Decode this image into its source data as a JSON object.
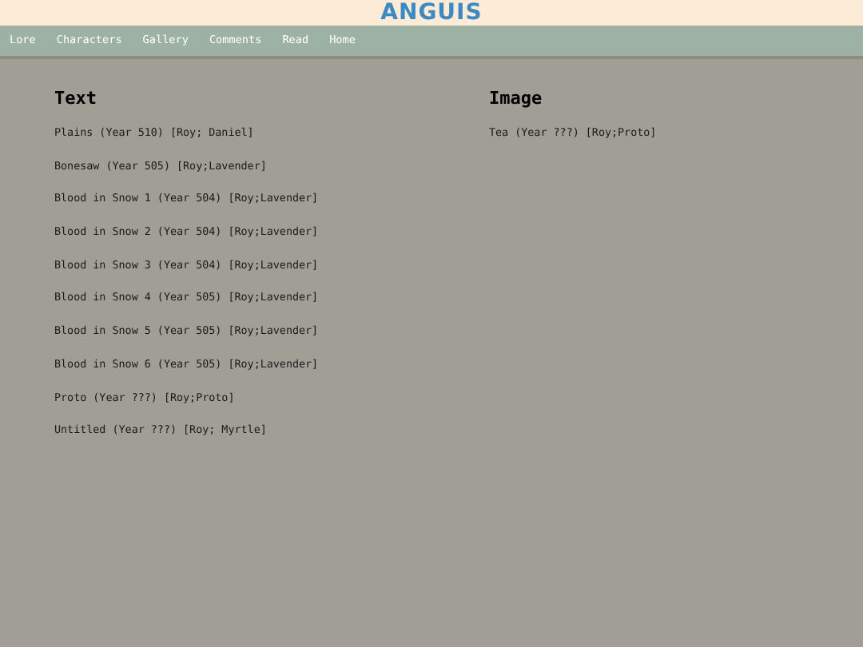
{
  "site_title": "ANGUIS",
  "nav": [
    "Lore",
    "Characters",
    "Gallery",
    "Comments",
    "Read",
    "Home"
  ],
  "sections": [
    {
      "heading": "Text",
      "entries": [
        "Plains (Year 510) [Roy; Daniel]",
        "Bonesaw (Year 505) [Roy;Lavender]",
        "Blood in Snow 1 (Year 504) [Roy;Lavender]",
        "Blood in Snow 2 (Year 504) [Roy;Lavender]",
        "Blood in Snow 3 (Year 504) [Roy;Lavender]",
        "Blood in Snow 4 (Year 505) [Roy;Lavender]",
        "Blood in Snow 5 (Year 505) [Roy;Lavender]",
        "Blood in Snow 6 (Year 505) [Roy;Lavender]",
        "Proto (Year ???) [Roy;Proto]",
        "Untitled (Year ???) [Roy; Myrtle]"
      ]
    },
    {
      "heading": "Image",
      "entries": [
        "Tea (Year ???) [Roy;Proto]"
      ]
    }
  ]
}
